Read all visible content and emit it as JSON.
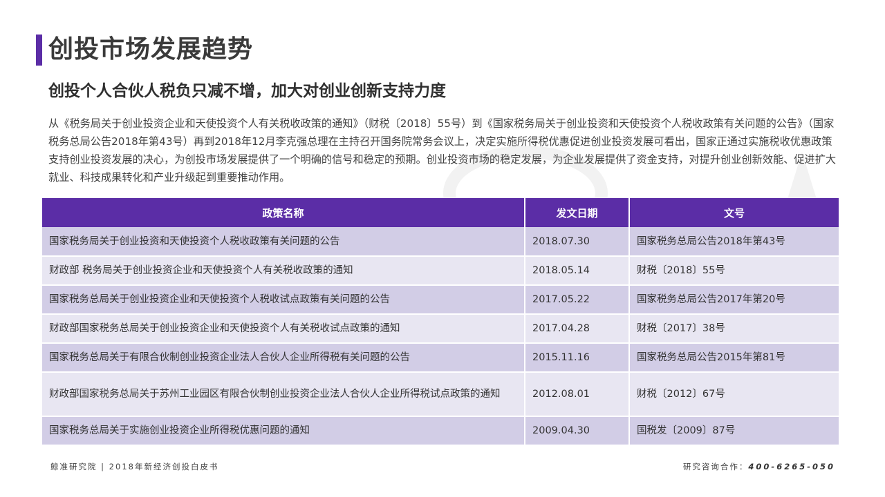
{
  "header": {
    "title": "创投市场发展趋势",
    "subtitle": "创投个人合伙人税负只减不增，加大对创业创新支持力度"
  },
  "intro": {
    "text": "从《税务局关于创业投资企业和天使投资个人有关税收政策的通知》（财税〔2018〕55号）到《国家税务局关于创业投资和天使投资个人税收政策有关问题的公告》（国家税务总局公告2018年第43号）再到2018年12月李克强总理在主持召开国务院常务会议上，决定实施所得税优惠促进创业投资发展可看出，国家正通过实施税收优惠政策支持创业投资发展的决心，为创投市场发展提供了一个明确的信号和稳定的预期。创业投资市场的稳定发展，为企业发展提供了资金支持，对提升创业创新效能、促进扩大就业、科技成果转化和产业升级起到重要推动作用。"
  },
  "table": {
    "headers": [
      "政策名称",
      "发文日期",
      "文号"
    ],
    "rows": [
      [
        "国家税务局关于创业投资和天使投资个人税收政策有关问题的公告",
        "2018.07.30",
        "国家税务总局公告2018年第43号"
      ],
      [
        "财政部 税务局关于创业投资企业和天使投资个人有关税收政策的通知",
        "2018.05.14",
        "财税〔2018〕55号"
      ],
      [
        "国家税务总局关于创业投资企业和天使投资个人税收试点政策有关问题的公告",
        "2017.05.22",
        "国家税务总局公告2017年第20号"
      ],
      [
        "财政部国家税务总局关于创业投资企业和天使投资个人有关税收试点政策的通知",
        "2017.04.28",
        "财税〔2017〕38号"
      ],
      [
        "国家税务总局关于有限合伙制创业投资企业法人合伙人企业所得税有关问题的公告",
        "2015.11.16",
        "国家税务总局公告2015年第81号"
      ],
      [
        "财政部国家税务总局关于苏州工业园区有限合伙制创业投资企业法人合伙人企业所得税试点政策的通知",
        "2012.08.01",
        "财税〔2012〕67号"
      ],
      [
        "国家税务总局关于实施创业投资企业所得税优惠问题的通知",
        "2009.04.30",
        "国税发〔2009〕87号"
      ]
    ]
  },
  "footer": {
    "left": "鲸准研究院 | 2018年新经济创投白皮书",
    "right_label": "研究咨询合作：",
    "phone": "400-6265-050"
  },
  "colors": {
    "accent": "#5b2da6",
    "row_odd": "#d2cde6",
    "row_even": "#e8e6f2"
  }
}
